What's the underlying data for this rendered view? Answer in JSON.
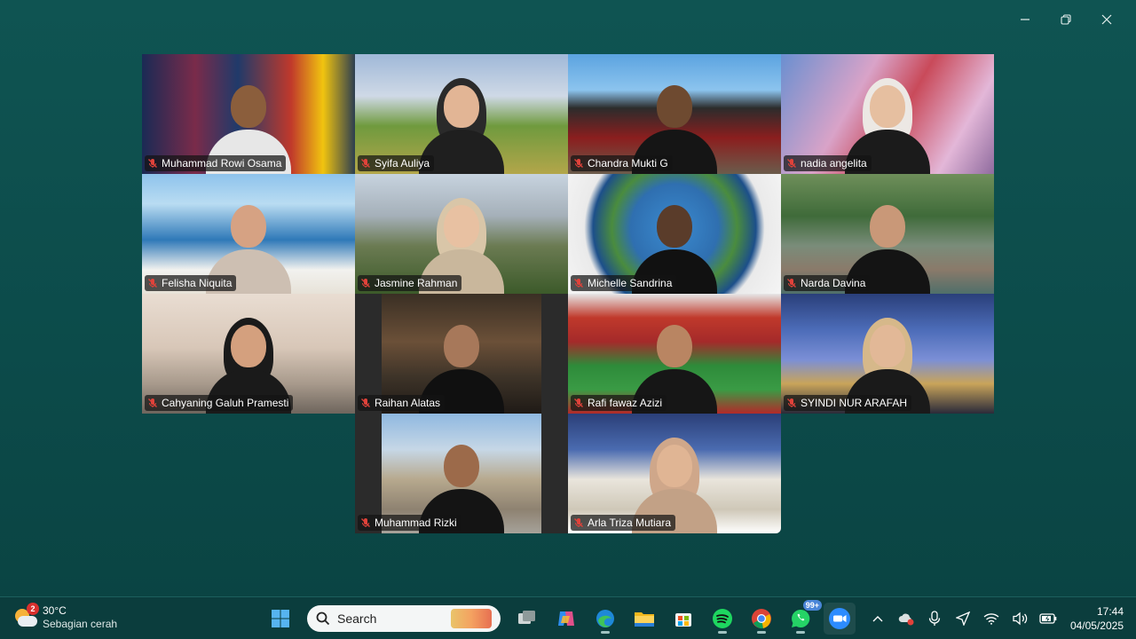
{
  "window": {
    "controls": {
      "minimize": "minimize-icon",
      "restore": "restore-icon",
      "close": "close-icon"
    }
  },
  "participants": [
    {
      "name": "Muhammad Rowi Osama",
      "mic": "muted",
      "scene": "city night neon"
    },
    {
      "name": "Syifa Auliya",
      "mic": "muted",
      "scene": "green hills",
      "active_speaker": true
    },
    {
      "name": "Chandra Mukti G",
      "mic": "muted",
      "scene": "korean palace"
    },
    {
      "name": "nadia angelita",
      "mic": "muted",
      "scene": "cherry blossom temple"
    },
    {
      "name": "Felisha Niquita",
      "mic": "muted",
      "scene": "santorini sea"
    },
    {
      "name": "Jasmine Rahman",
      "mic": "muted",
      "scene": "campus"
    },
    {
      "name": "Michelle Sandrina",
      "mic": "muted",
      "scene": "globe"
    },
    {
      "name": "Narda Davina",
      "mic": "muted",
      "scene": "jungle elephant"
    },
    {
      "name": "Cahyaning Galuh Pramesti",
      "mic": "muted",
      "scene": "city skyline"
    },
    {
      "name": "Raihan Alatas",
      "mic": "muted",
      "scene": "cafe"
    },
    {
      "name": "Rafi fawaz Azizi",
      "mic": "muted",
      "scene": "stadium"
    },
    {
      "name": "SYINDI NUR ARAFAH",
      "mic": "muted",
      "scene": "city night"
    },
    {
      "name": "Muhammad Rizki",
      "mic": "muted",
      "scene": "parthenon"
    },
    {
      "name": "Arla Triza Mutiara",
      "mic": "muted",
      "scene": "mecca"
    }
  ],
  "taskbar": {
    "weather": {
      "temp": "30°C",
      "condition": "Sebagian cerah",
      "badge": "2"
    },
    "search": {
      "placeholder": "Search"
    },
    "apps": [
      "start-icon",
      "task-view-icon",
      "copilot-icon",
      "edge-icon",
      "file-explorer-icon",
      "store-icon",
      "spotify-icon",
      "chrome-icon",
      "whatsapp-icon",
      "zoom-icon"
    ],
    "whatsapp_badge": "99+",
    "clock": {
      "time": "17:44",
      "date": "04/05/2025"
    }
  },
  "colors": {
    "background": "#0f5452",
    "taskbar": "#0b3d3d",
    "active_speaker_border": "#3fd08a",
    "mic_muted": "#e0423a"
  }
}
